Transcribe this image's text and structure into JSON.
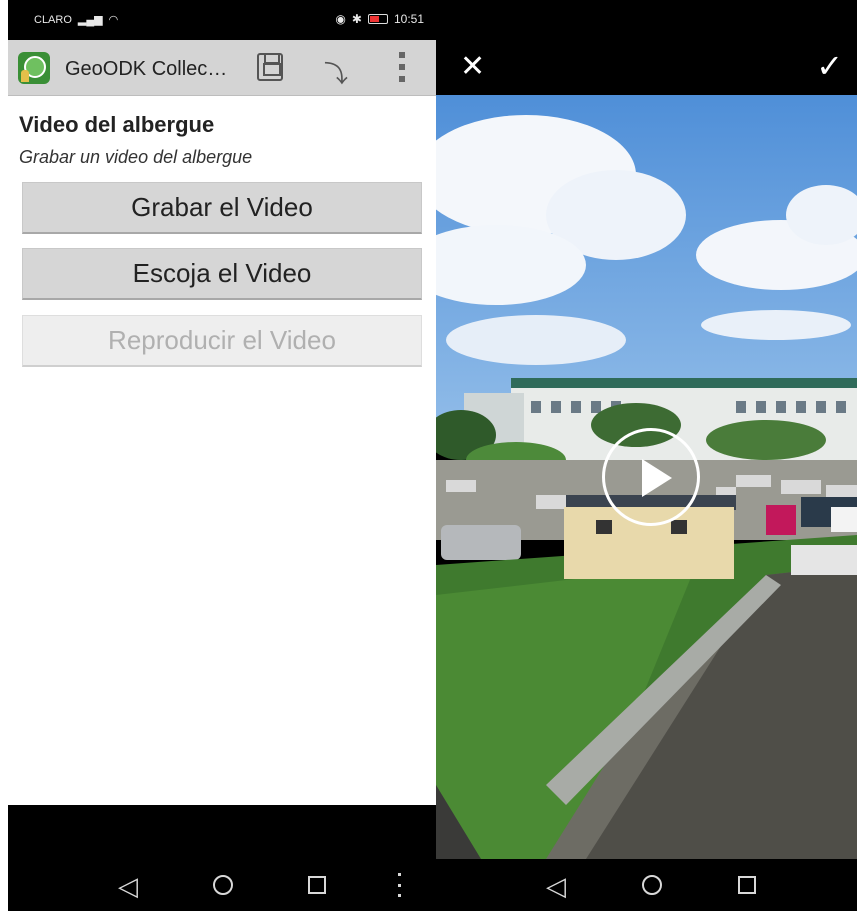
{
  "status": {
    "carrier": "CLARO",
    "time": "10:51"
  },
  "appbar": {
    "title": "GeoODK Collec…"
  },
  "question": {
    "label": "Video del albergue",
    "hint": "Grabar un video del albergue"
  },
  "buttons": {
    "record": "Grabar el Video",
    "choose": "Escoja el Video",
    "play": "Reproducir el Video"
  },
  "viewer": {
    "close": "✕",
    "confirm": "✓"
  },
  "nav": {
    "back": "◁"
  },
  "colors": {
    "appbar": "#d4d4d4",
    "button": "#d6d6d6",
    "disabled_text": "#b0b0b0"
  }
}
